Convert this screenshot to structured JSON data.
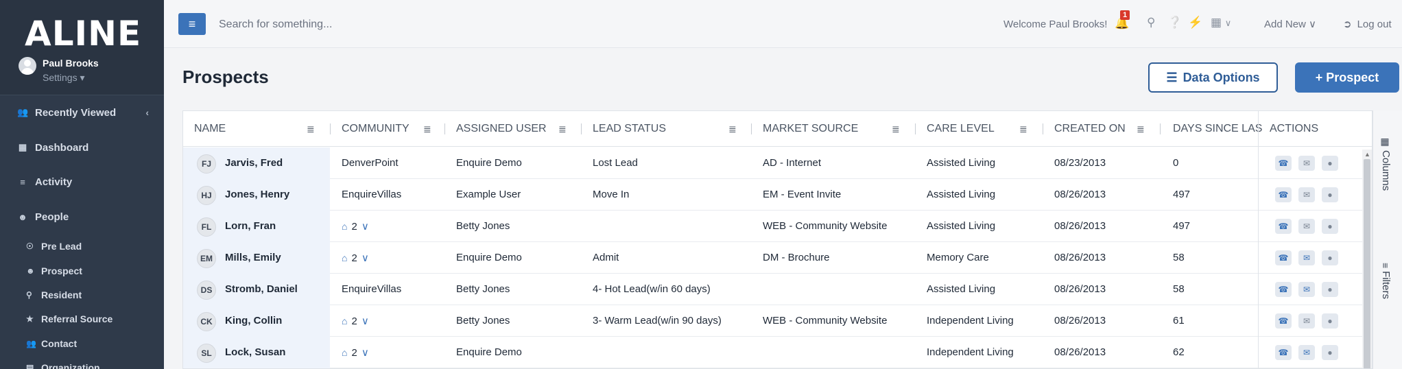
{
  "app": {
    "logo": "ALINE"
  },
  "user": {
    "name": "Paul Brooks",
    "settings_label": "Settings ▾"
  },
  "sidebar": {
    "items": [
      {
        "label": "Recently Viewed",
        "icon": "users-icon",
        "glyph": "👥"
      },
      {
        "label": "Dashboard",
        "icon": "dashboard-icon",
        "glyph": "▦"
      },
      {
        "label": "Activity",
        "icon": "list-icon",
        "glyph": "≡"
      },
      {
        "label": "People",
        "icon": "person-icon",
        "glyph": "☻"
      }
    ],
    "sub_items": [
      {
        "label": "Pre Lead",
        "glyph": "☉"
      },
      {
        "label": "Prospect",
        "glyph": "☻"
      },
      {
        "label": "Resident",
        "glyph": "⚲"
      },
      {
        "label": "Referral Source",
        "glyph": "★"
      },
      {
        "label": "Contact",
        "glyph": "👥"
      },
      {
        "label": "Organization",
        "glyph": "▤"
      }
    ]
  },
  "topbar": {
    "search_placeholder": "Search for something...",
    "welcome": "Welcome Paul Brooks!",
    "notification_count": "1",
    "add_new": "Add New ∨",
    "logout": "Log out"
  },
  "page": {
    "title": "Prospects",
    "data_options_label": "Data Options",
    "add_prospect_label": "+ Prospect"
  },
  "table": {
    "columns": [
      "NAME",
      "COMMUNITY",
      "ASSIGNED USER",
      "LEAD STATUS",
      "MARKET SOURCE",
      "CARE LEVEL",
      "CREATED ON",
      "DAYS SINCE LAS",
      "ACTIONS"
    ],
    "rows": [
      {
        "initials": "FJ",
        "name": "Jarvis, Fred",
        "community": "DenverPoint",
        "community_count": "",
        "assigned_user": "Enquire Demo",
        "lead_status": "Lost Lead",
        "market_source": "AD - Internet",
        "care_level": "Assisted Living",
        "created_on": "08/23/2013",
        "days_since": "0",
        "email_active": false
      },
      {
        "initials": "HJ",
        "name": "Jones, Henry",
        "community": "EnquireVillas",
        "community_count": "",
        "assigned_user": "Example User",
        "lead_status": "Move In",
        "market_source": "EM - Event Invite",
        "care_level": "Assisted Living",
        "created_on": "08/26/2013",
        "days_since": "497",
        "email_active": false
      },
      {
        "initials": "FL",
        "name": "Lorn, Fran",
        "community": "",
        "community_count": "2",
        "assigned_user": "Betty Jones",
        "lead_status": "",
        "market_source": "WEB - Community Website",
        "care_level": "Assisted Living",
        "created_on": "08/26/2013",
        "days_since": "497",
        "email_active": false
      },
      {
        "initials": "EM",
        "name": "Mills, Emily",
        "community": "",
        "community_count": "2",
        "assigned_user": "Enquire Demo",
        "lead_status": "Admit",
        "market_source": "DM - Brochure",
        "care_level": "Memory Care",
        "created_on": "08/26/2013",
        "days_since": "58",
        "email_active": true
      },
      {
        "initials": "DS",
        "name": "Stromb, Daniel",
        "community": "EnquireVillas",
        "community_count": "",
        "assigned_user": "Betty Jones",
        "lead_status": "4- Hot Lead(w/in 60 days)",
        "market_source": "",
        "care_level": "Assisted Living",
        "created_on": "08/26/2013",
        "days_since": "58",
        "email_active": true
      },
      {
        "initials": "CK",
        "name": "King, Collin",
        "community": "",
        "community_count": "2",
        "assigned_user": "Betty Jones",
        "lead_status": "3- Warm Lead(w/in 90 days)",
        "market_source": "WEB - Community Website",
        "care_level": "Independent Living",
        "created_on": "08/26/2013",
        "days_since": "61",
        "email_active": false
      },
      {
        "initials": "SL",
        "name": "Lock, Susan",
        "community": "",
        "community_count": "2",
        "assigned_user": "Enquire Demo",
        "lead_status": "",
        "market_source": "",
        "care_level": "Independent Living",
        "created_on": "08/26/2013",
        "days_since": "62",
        "email_active": true
      }
    ]
  },
  "side_panel": {
    "columns_label": "Columns",
    "filters_label": "Filters"
  },
  "colors": {
    "sidebar_bg": "#2f3a4a",
    "accent": "#3b73b9",
    "outline_button": "#2f5d97",
    "badge": "#d9392b"
  }
}
